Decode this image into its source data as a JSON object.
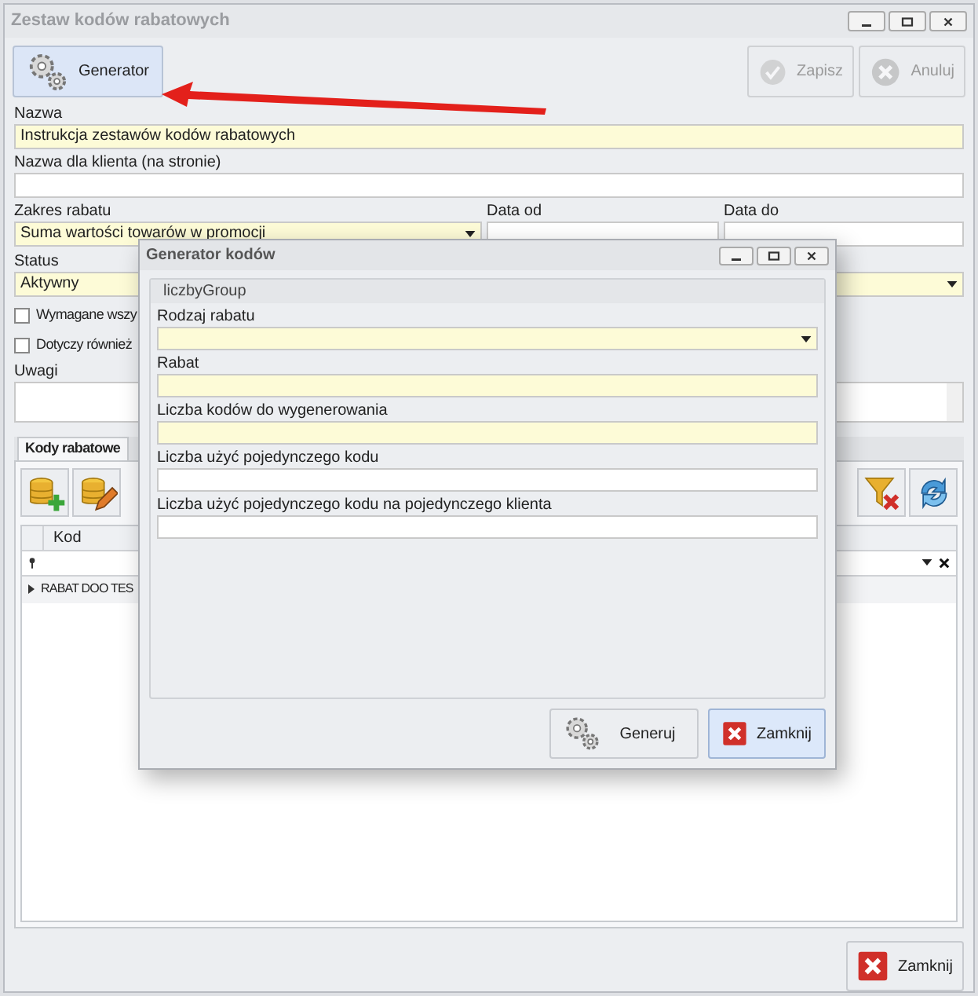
{
  "window": {
    "title": "Zestaw kodów rabatowych"
  },
  "toolbar": [
    {
      "label": "Generator",
      "kind": "gear",
      "disabled": false
    },
    {
      "label": "Zapisz",
      "kind": "check",
      "disabled": true
    },
    {
      "label": "Anuluj",
      "kind": "cancel",
      "disabled": true
    }
  ],
  "form": {
    "name": {
      "label": "Nazwa",
      "value": "Instrukcja zestawów kodów rabatowych",
      "required": true
    },
    "client_name": {
      "label": "Nazwa dla klienta (na stronie)",
      "required": false
    },
    "discount_scope": {
      "label": "Zakres rabatu",
      "value": "Suma wartości towarów w promocji",
      "required": true
    },
    "date_from": {
      "label": "Data od",
      "required": false
    },
    "date_to": {
      "label": "Data do",
      "required": false
    },
    "status": {
      "label": "Status",
      "value": "Aktywny",
      "required": true
    },
    "checkboxes": [
      {
        "label": "Wymagane wszy",
        "checked": false
      },
      {
        "label": "Dotyczy również",
        "checked": false
      }
    ],
    "notes": {
      "label": "Uwagi"
    }
  },
  "tabs": [
    {
      "label": "Kody rabatowe",
      "selected": true
    }
  ],
  "grid_toolbar_left": [
    {
      "kind": "add"
    },
    {
      "kind": "edit"
    }
  ],
  "grid_toolbar_right": [
    {
      "kind": "filter-clear"
    },
    {
      "kind": "refresh"
    }
  ],
  "grid": {
    "columns": [
      "Kod"
    ],
    "rows": [
      {
        "cells": [
          "RABAT DOO TES"
        ],
        "current": true
      }
    ]
  },
  "footer_button": {
    "label": "Zamknij"
  },
  "dialog": {
    "title": "Generator kodów",
    "group": "liczbyGroup",
    "fields": [
      {
        "label": "Rodzaj rabatu",
        "kind": "dropdown",
        "required": true
      },
      {
        "label": "Rabat",
        "kind": "text",
        "required": true
      },
      {
        "label": "Liczba kodów do wygenerowania",
        "kind": "text",
        "required": true
      },
      {
        "label": "Liczba użyć pojedynczego kodu",
        "kind": "text",
        "required": false
      },
      {
        "label": "Liczba użyć pojedynczego kodu na pojedynczego klienta",
        "kind": "text",
        "required": false
      }
    ],
    "buttons": [
      {
        "label": "Generuj",
        "kind": "gear",
        "focused": false
      },
      {
        "label": "Zamknij",
        "kind": "close",
        "focused": true
      }
    ]
  }
}
